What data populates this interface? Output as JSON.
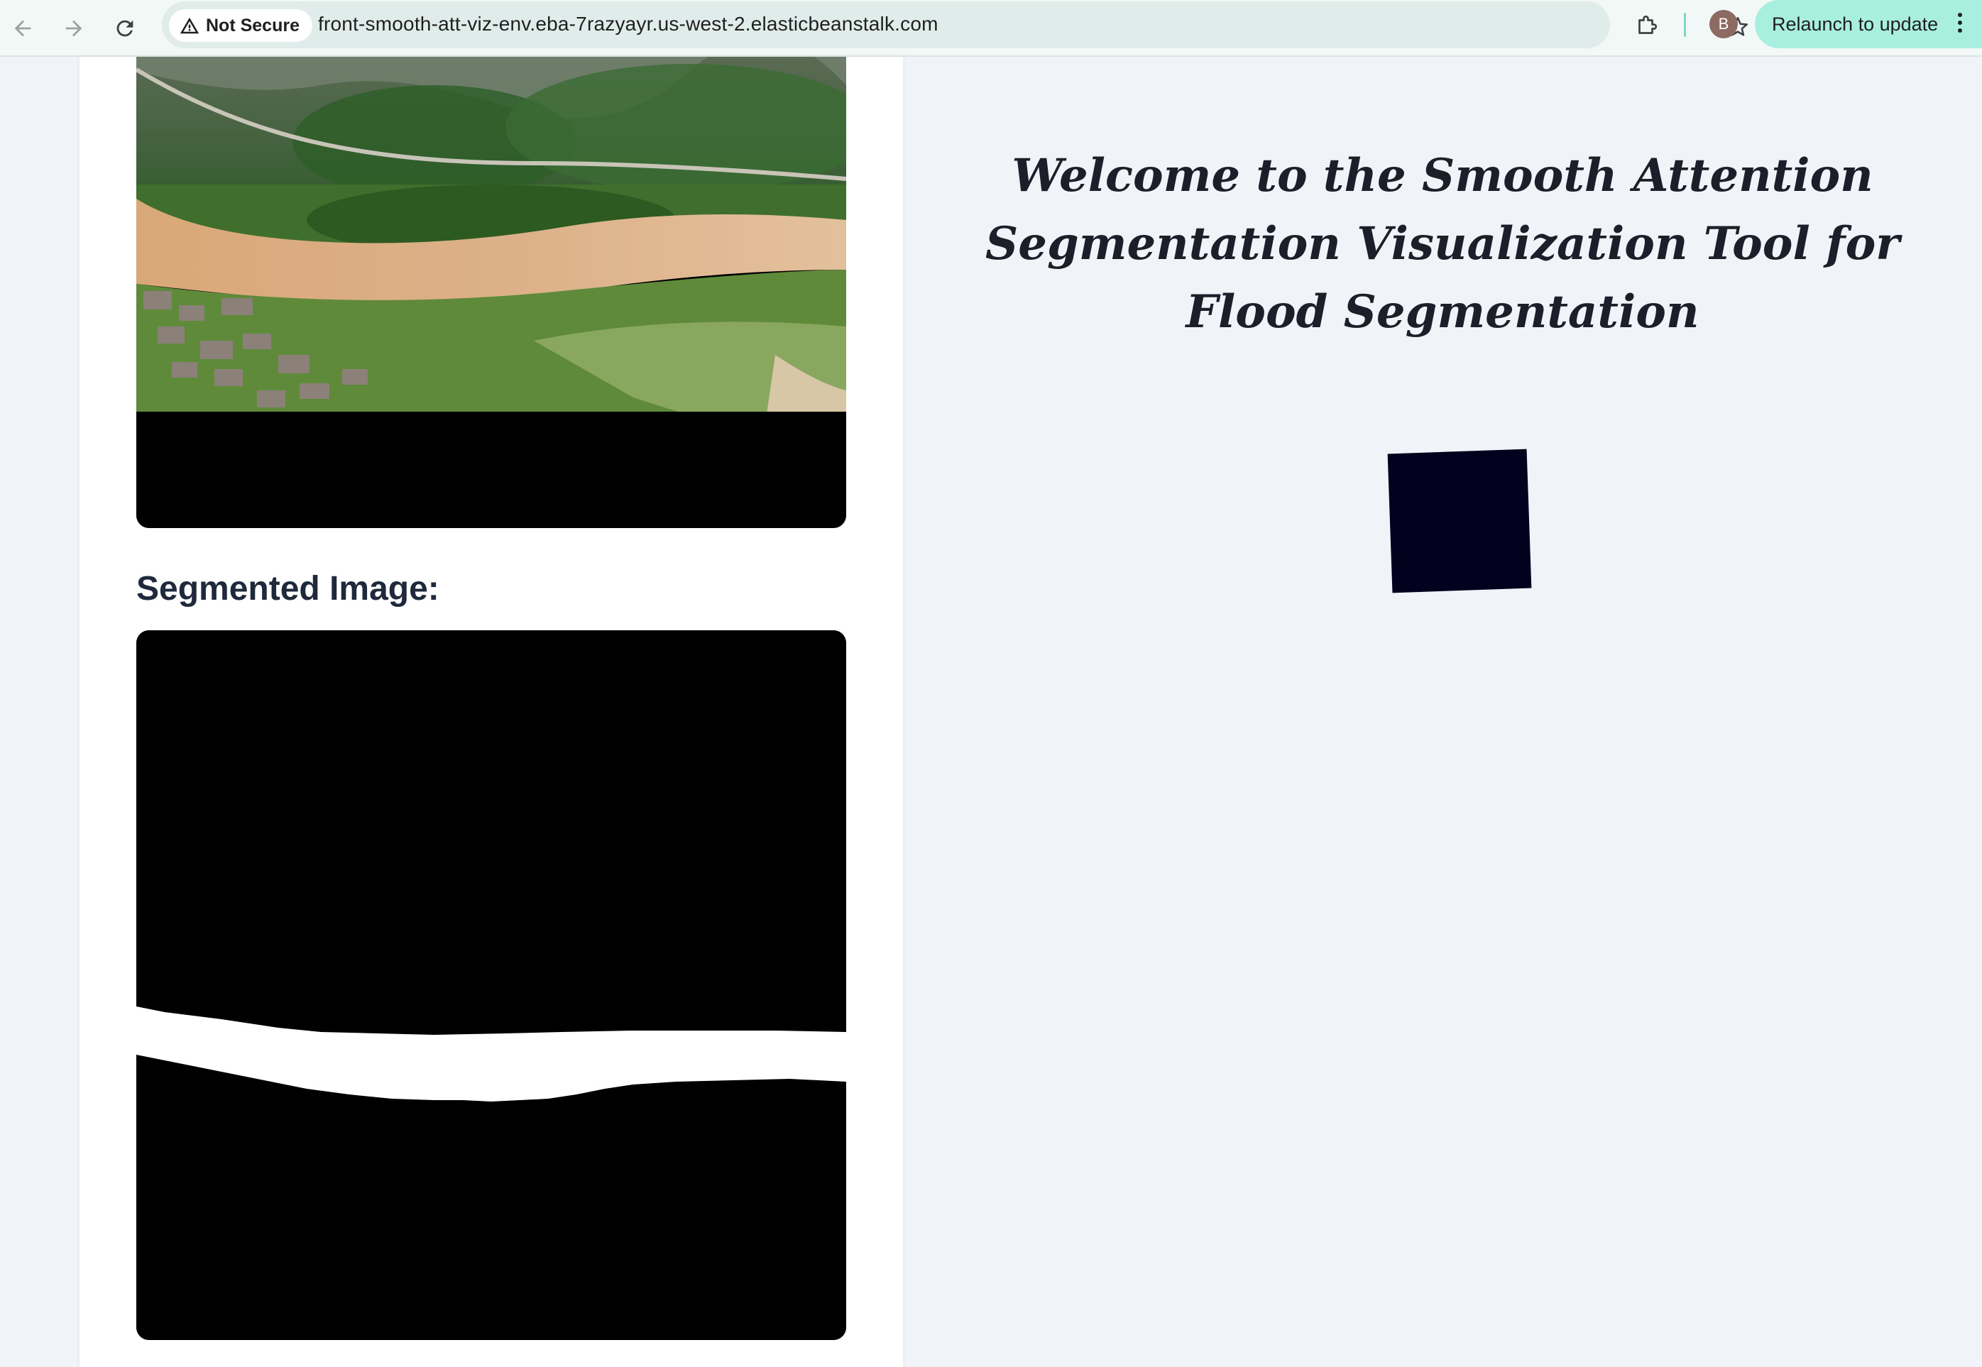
{
  "browser": {
    "security_label": "Not Secure",
    "url": "front-smooth-att-viz-env.eba-7razyayr.us-west-2.elasticbeanstalk.com",
    "profile_initial": "B",
    "relaunch_label": "Relaunch to update",
    "icons": [
      "back-arrow-icon",
      "forward-arrow-icon",
      "reload-icon",
      "warning-icon",
      "star-icon",
      "extensions-icon",
      "more-vert-icon"
    ]
  },
  "left_panel": {
    "segmented_heading": "Segmented Image:"
  },
  "right_panel": {
    "welcome_title": "Welcome to the Smooth Attention Segmentation Visualization Tool for Flood Segmentation"
  },
  "colors": {
    "toolbar_bg": "#f1f8f6",
    "relaunch_bg": "#a8efe0",
    "page_bg": "#f0f3f8",
    "loader_square": "#02021e",
    "heading_text": "#1e293b"
  }
}
